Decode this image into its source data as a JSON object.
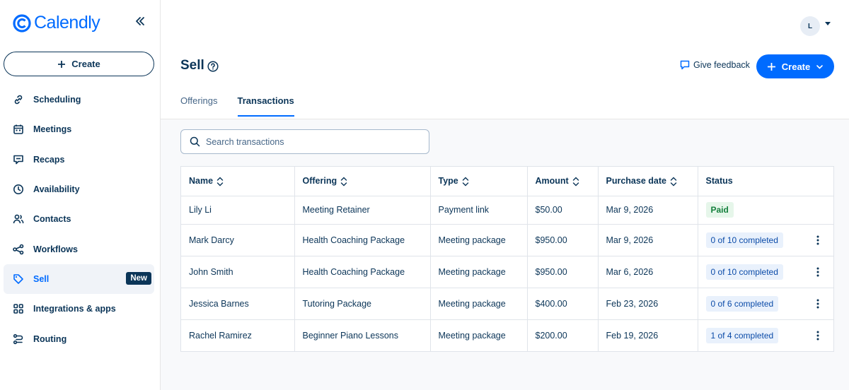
{
  "brand": {
    "name": "Calendly",
    "color": "#006bff"
  },
  "sidebar": {
    "create_label": "Create",
    "items": [
      {
        "label": "Scheduling",
        "icon": "link-icon"
      },
      {
        "label": "Meetings",
        "icon": "calendar-icon"
      },
      {
        "label": "Recaps",
        "icon": "recap-icon"
      },
      {
        "label": "Availability",
        "icon": "clock-icon"
      },
      {
        "label": "Contacts",
        "icon": "people-icon"
      },
      {
        "label": "Workflows",
        "icon": "workflow-icon"
      },
      {
        "label": "Sell",
        "icon": "tag-icon",
        "active": true,
        "badge": "New"
      },
      {
        "label": "Integrations & apps",
        "icon": "grid-icon"
      },
      {
        "label": "Routing",
        "icon": "routing-icon"
      }
    ]
  },
  "header": {
    "avatar_initial": "L",
    "title": "Sell",
    "feedback_label": "Give feedback",
    "create_label": "Create",
    "tabs": [
      {
        "label": "Offerings",
        "active": false
      },
      {
        "label": "Transactions",
        "active": true
      }
    ]
  },
  "search": {
    "placeholder": "Search transactions"
  },
  "table": {
    "columns": [
      "Name",
      "Offering",
      "Type",
      "Amount",
      "Purchase date",
      "Status"
    ],
    "rows": [
      {
        "name": "Lily Li",
        "offering": "Meeting Retainer",
        "type": "Payment link",
        "amount": "$50.00",
        "date": "Mar 9, 2026",
        "status": "Paid",
        "status_kind": "paid"
      },
      {
        "name": "Mark Darcy",
        "offering": "Health Coaching Package",
        "type": "Meeting package",
        "amount": "$950.00",
        "date": "Mar 9, 2026",
        "status": "0 of 10 completed",
        "status_kind": "progress"
      },
      {
        "name": "John Smith",
        "offering": "Health Coaching Package",
        "type": "Meeting package",
        "amount": "$950.00",
        "date": "Mar 6, 2026",
        "status": "0 of 10 completed",
        "status_kind": "progress"
      },
      {
        "name": "Jessica Barnes",
        "offering": "Tutoring Package",
        "type": "Meeting package",
        "amount": "$400.00",
        "date": "Feb 23, 2026",
        "status": "0 of 6 completed",
        "status_kind": "progress"
      },
      {
        "name": "Rachel Ramirez",
        "offering": "Beginner Piano Lessons",
        "type": "Meeting package",
        "amount": "$200.00",
        "date": "Feb 19, 2026",
        "status": "1 of 4 completed",
        "status_kind": "progress"
      }
    ]
  }
}
